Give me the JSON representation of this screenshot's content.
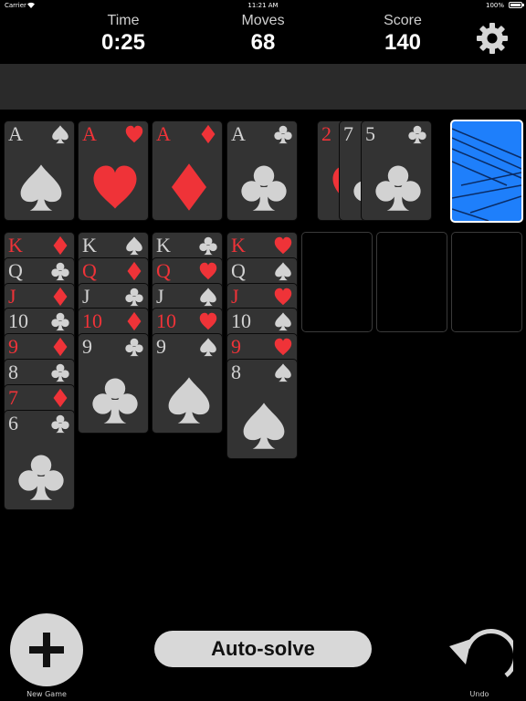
{
  "status_bar": {
    "carrier": "Carrier",
    "time": "11:21 AM",
    "battery": "100%",
    "battery_level": 1.0
  },
  "header": {
    "time": {
      "label": "Time",
      "value": "0:25"
    },
    "moves": {
      "label": "Moves",
      "value": "68"
    },
    "score": {
      "label": "Score",
      "value": "140"
    },
    "settings_icon": "gear-icon"
  },
  "foundations": [
    {
      "rank": "A",
      "suit": "spade",
      "color": "gray"
    },
    {
      "rank": "A",
      "suit": "heart",
      "color": "red"
    },
    {
      "rank": "A",
      "suit": "diamond",
      "color": "red"
    },
    {
      "rank": "A",
      "suit": "club",
      "color": "gray"
    }
  ],
  "waste": [
    {
      "rank": "2",
      "suit": "heart",
      "color": "red"
    },
    {
      "rank": "7",
      "suit": "club",
      "color": "gray"
    },
    {
      "rank": "5",
      "suit": "club",
      "color": "gray"
    }
  ],
  "stock": {
    "face": "down"
  },
  "tableau": [
    [
      {
        "rank": "K",
        "suit": "diamond",
        "color": "red"
      },
      {
        "rank": "Q",
        "suit": "club",
        "color": "gray"
      },
      {
        "rank": "J",
        "suit": "diamond",
        "color": "red"
      },
      {
        "rank": "10",
        "suit": "club",
        "color": "gray"
      },
      {
        "rank": "9",
        "suit": "diamond",
        "color": "red"
      },
      {
        "rank": "8",
        "suit": "club",
        "color": "gray"
      },
      {
        "rank": "7",
        "suit": "diamond",
        "color": "red"
      },
      {
        "rank": "6",
        "suit": "club",
        "color": "gray"
      }
    ],
    [
      {
        "rank": "K",
        "suit": "spade",
        "color": "gray"
      },
      {
        "rank": "Q",
        "suit": "diamond",
        "color": "red"
      },
      {
        "rank": "J",
        "suit": "club",
        "color": "gray"
      },
      {
        "rank": "10",
        "suit": "diamond",
        "color": "red"
      },
      {
        "rank": "9",
        "suit": "club",
        "color": "gray"
      }
    ],
    [
      {
        "rank": "K",
        "suit": "club",
        "color": "gray"
      },
      {
        "rank": "Q",
        "suit": "heart",
        "color": "red"
      },
      {
        "rank": "J",
        "suit": "spade",
        "color": "gray"
      },
      {
        "rank": "10",
        "suit": "heart",
        "color": "red"
      },
      {
        "rank": "9",
        "suit": "spade",
        "color": "gray"
      }
    ],
    [
      {
        "rank": "K",
        "suit": "heart",
        "color": "red"
      },
      {
        "rank": "Q",
        "suit": "spade",
        "color": "gray"
      },
      {
        "rank": "J",
        "suit": "heart",
        "color": "red"
      },
      {
        "rank": "10",
        "suit": "spade",
        "color": "gray"
      },
      {
        "rank": "9",
        "suit": "heart",
        "color": "red"
      },
      {
        "rank": "8",
        "suit": "spade",
        "color": "gray"
      }
    ],
    [],
    [],
    []
  ],
  "footer": {
    "new_game_label": "New Game",
    "new_game_icon": "plus-icon",
    "autosolve_label": "Auto-solve",
    "undo_label": "Undo",
    "undo_icon": "undo-arrow-icon"
  },
  "colors": {
    "red": "#ef3338",
    "gray": "#d2d2d2",
    "card_face": "#333333",
    "card_back": "#1e7ffb",
    "bar": "#2a2a2a"
  }
}
